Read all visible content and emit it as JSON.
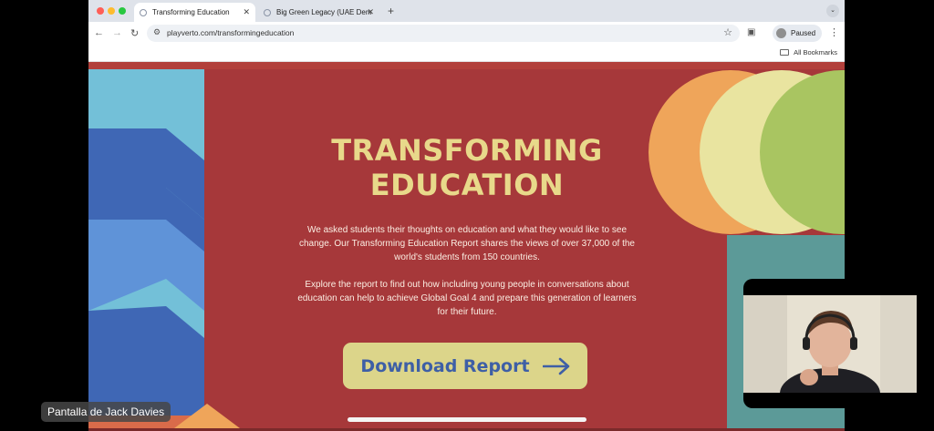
{
  "browser": {
    "tabs": [
      {
        "label": "Transforming Education",
        "active": true
      },
      {
        "label": "Big Green Legacy (UAE Dem",
        "active": false
      }
    ],
    "new_tab_label": "+",
    "url": "playverto.com/transformingeducation",
    "profile_label": "Paused",
    "bookmarks_label": "All Bookmarks"
  },
  "page": {
    "title_line1": "TRANSFORMING",
    "title_line2": "EDUCATION",
    "paragraph1": "We asked students their thoughts on education and what they would like to see change. Our Transforming Education Report shares the views of over 37,000 of the world's students from 150 countries.",
    "paragraph2": "Explore the report to find out how including young people in conversations about education can help to achieve Global Goal 4 and prepare this generation of learners for their future.",
    "download_button": "Download Report"
  },
  "meeting": {
    "screen_share_label": "Pantalla de Jack Davies"
  },
  "colors": {
    "page_red": "#a6383a",
    "title_yellow": "#e8d98a",
    "button_bg": "#dcd58a",
    "button_text": "#3e5fa6",
    "accent_blue": "#3f67b5",
    "accent_sky": "#73c0d8",
    "accent_orange": "#efa55a",
    "accent_green": "#a9c561"
  },
  "icons": [
    "close-icon",
    "back-icon",
    "forward-icon",
    "reload-icon",
    "star-icon",
    "extensions-icon",
    "kebab-menu-icon",
    "folder-icon",
    "arrow-right-icon"
  ]
}
